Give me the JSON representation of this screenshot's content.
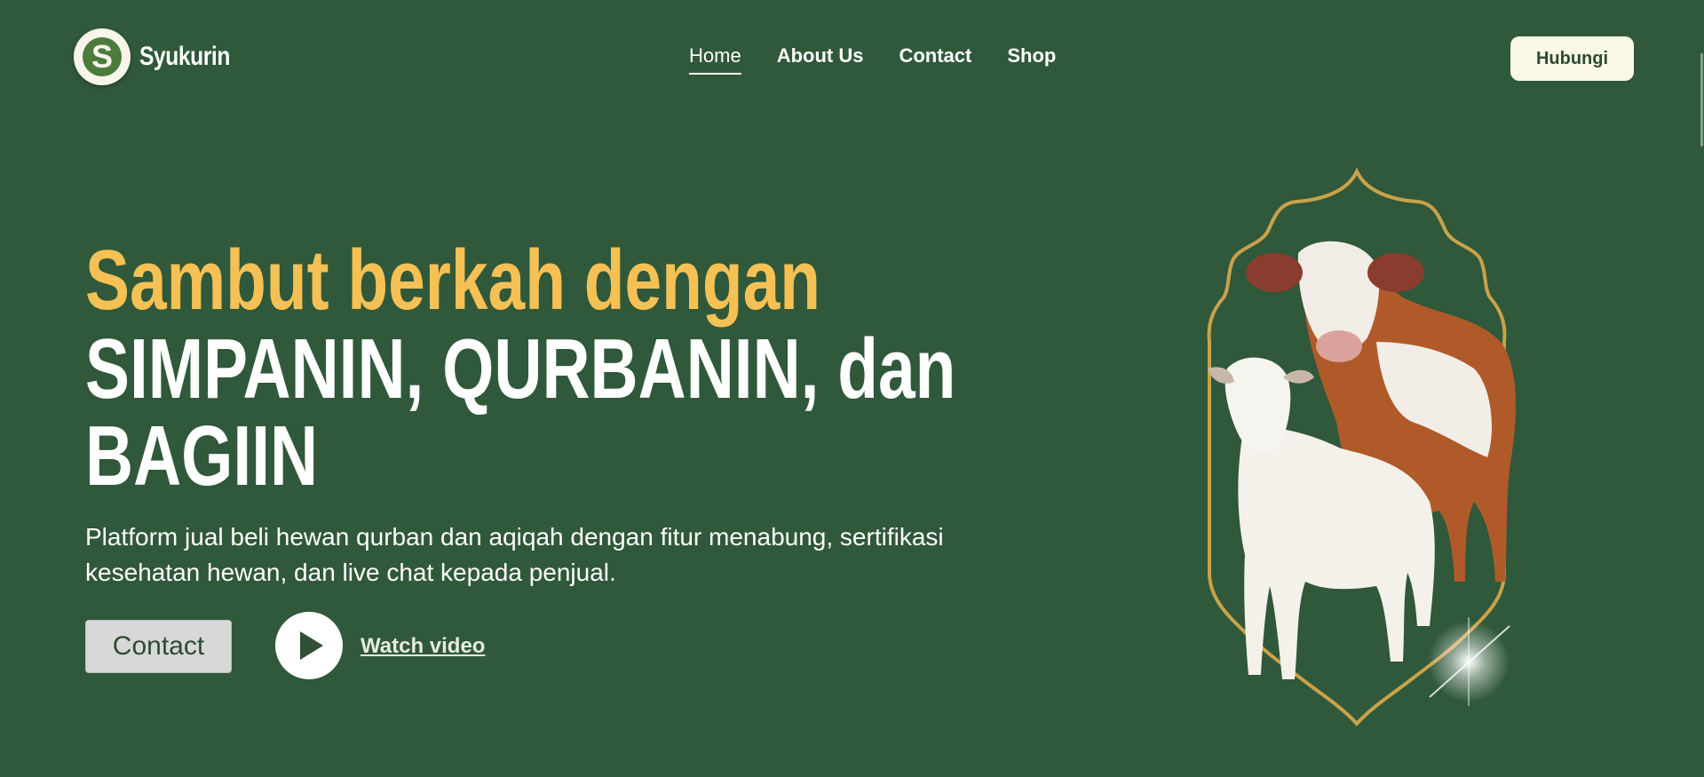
{
  "brand": {
    "name": "Syukurin",
    "logo_letter": "S"
  },
  "nav": {
    "items": [
      {
        "label": "Home",
        "active": true
      },
      {
        "label": "About Us",
        "active": false
      },
      {
        "label": "Contact",
        "active": false
      },
      {
        "label": "Shop",
        "active": false
      }
    ]
  },
  "header": {
    "cta_label": "Hubungi"
  },
  "hero": {
    "headline_line1": "Sambut berkah dengan",
    "headline_line2": "SIMPANIN, QURBANIN, dan",
    "headline_line3": "BAGIIN",
    "description": "Platform jual beli hewan qurban dan aqiqah dengan fitur menabung, sertifikasi kesehatan hewan, dan live chat kepada penjual.",
    "contact_label": "Contact",
    "watch_label": "Watch video",
    "play_icon": "play-icon"
  },
  "colors": {
    "background": "#30583a",
    "accent_yellow": "#f6c154",
    "button_cream": "#fbf8e6",
    "frame_gold": "#c9a24a"
  }
}
